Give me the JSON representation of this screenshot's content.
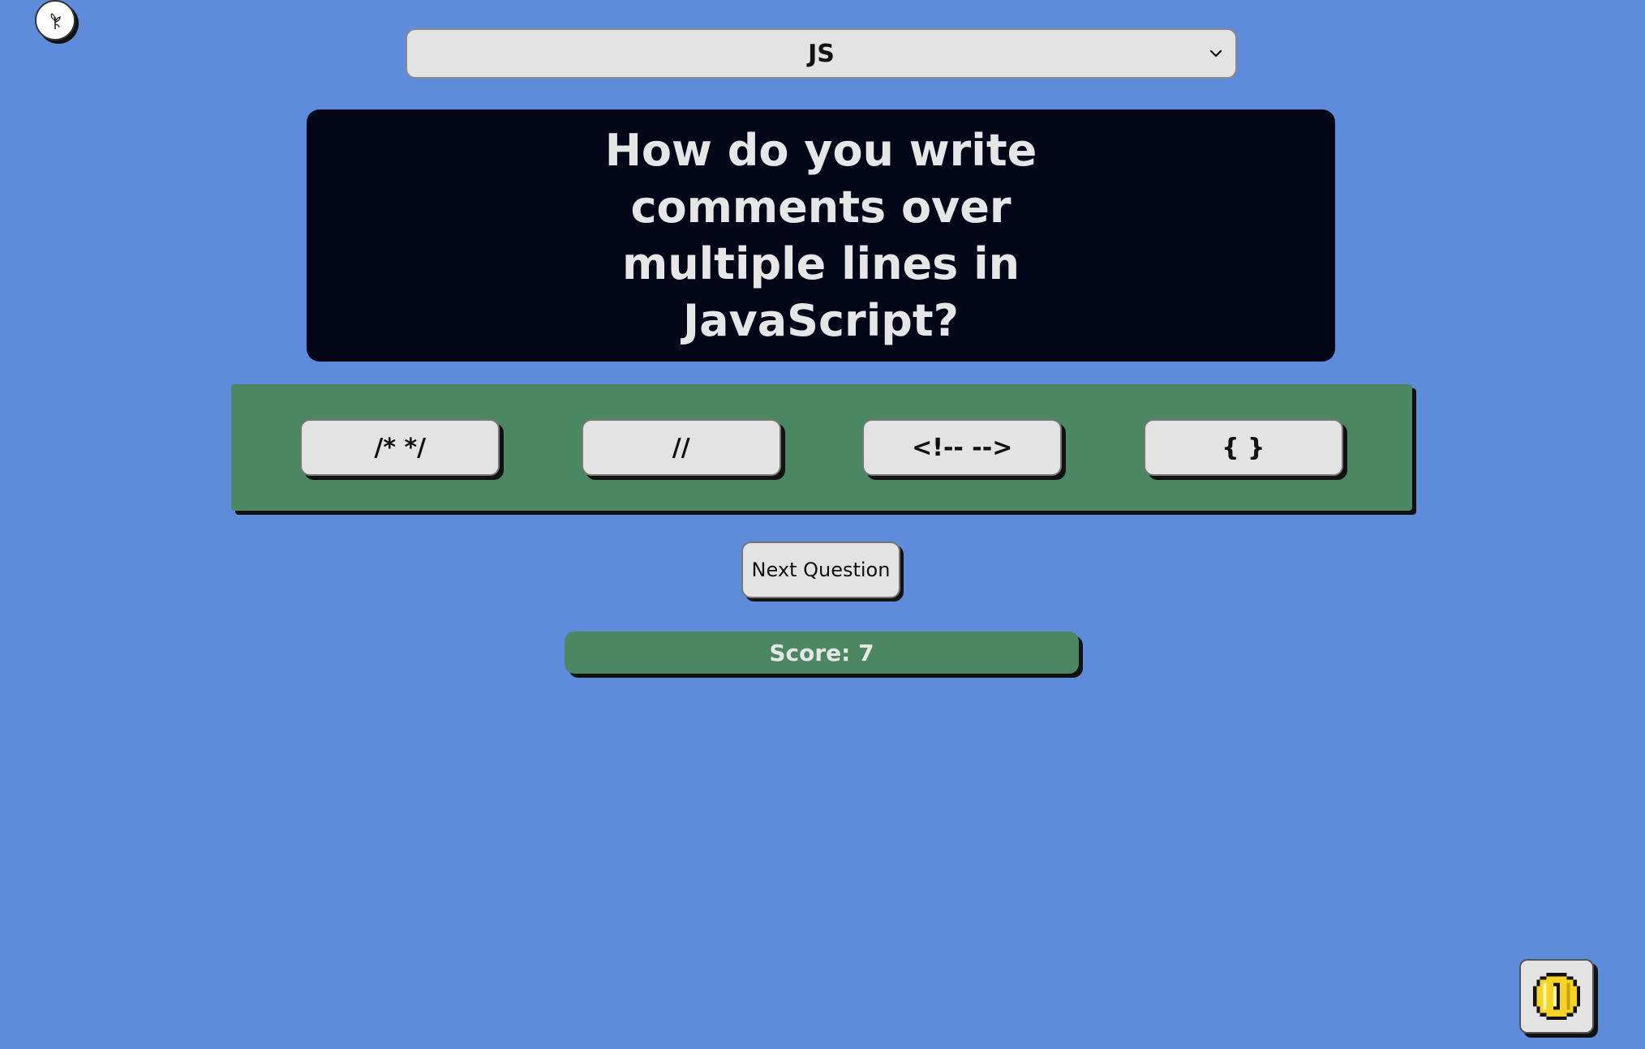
{
  "header": {
    "corner_icon": "plant-icon",
    "language_select": {
      "selected": "JS",
      "icon": "chevron-down-icon"
    }
  },
  "question": {
    "text": "How do you write comments over multiple lines in JavaScript?"
  },
  "answers": [
    {
      "label": "/* */"
    },
    {
      "label": "//"
    },
    {
      "label": "<!-- -->"
    },
    {
      "label": "{ }"
    }
  ],
  "controls": {
    "next_label": "Next Question"
  },
  "score": {
    "label": "Score: 7"
  },
  "coin": {
    "icon": "coin-icon"
  },
  "colors": {
    "background": "#5e8bda",
    "question_card": "#020617",
    "panel_green": "#4b8762",
    "button_gray": "#e3e3e3",
    "coin_yellow": "#f5d328"
  }
}
